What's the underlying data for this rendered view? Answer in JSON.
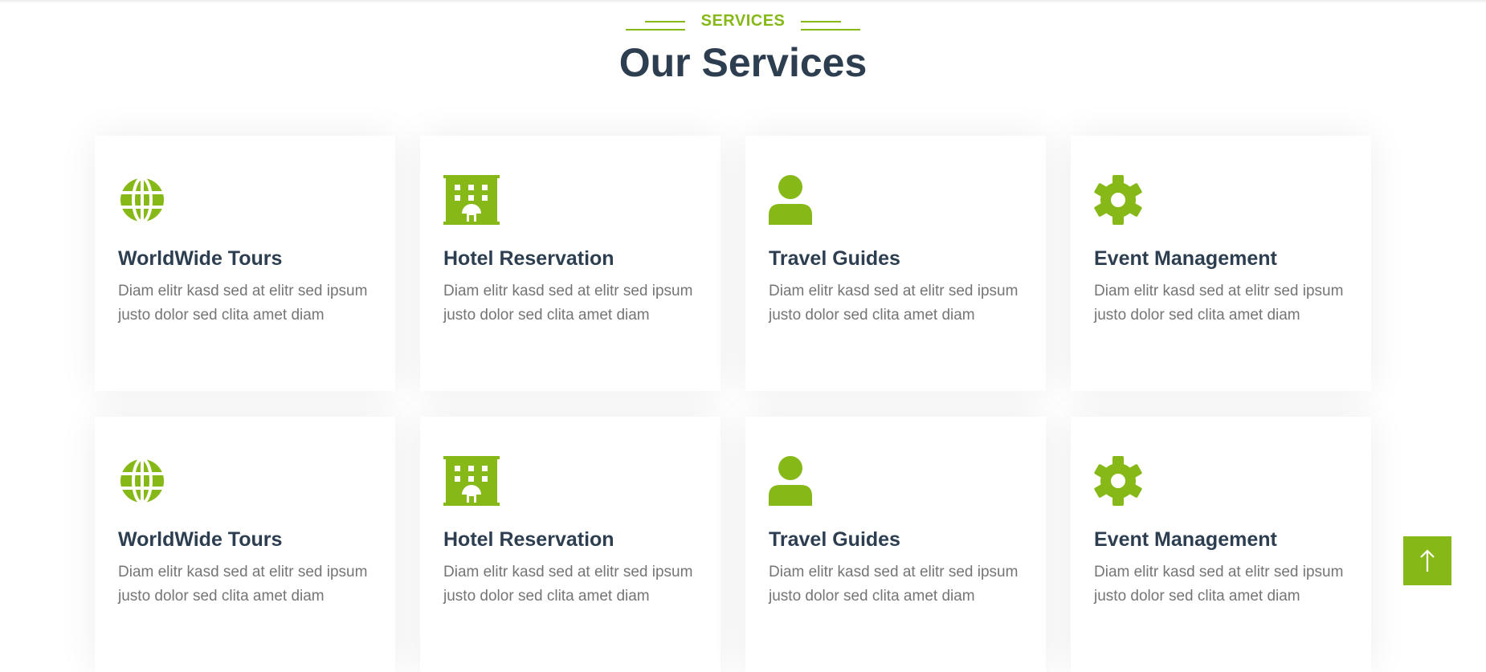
{
  "section": {
    "eyebrow": "SERVICES",
    "title": "Our Services"
  },
  "colors": {
    "accent": "#86b817",
    "heading": "#2c3e50",
    "body_text": "#757575"
  },
  "services": [
    {
      "title": "WorldWide Tours",
      "description": "Diam elitr kasd sed at elitr sed ipsum justo dolor sed clita amet diam",
      "icon": "globe-icon"
    },
    {
      "title": "Hotel Reservation",
      "description": "Diam elitr kasd sed at elitr sed ipsum justo dolor sed clita amet diam",
      "icon": "hotel-icon"
    },
    {
      "title": "Travel Guides",
      "description": "Diam elitr kasd sed at elitr sed ipsum justo dolor sed clita amet diam",
      "icon": "user-icon"
    },
    {
      "title": "Event Management",
      "description": "Diam elitr kasd sed at elitr sed ipsum justo dolor sed clita amet diam",
      "icon": "cog-icon"
    },
    {
      "title": "WorldWide Tours",
      "description": "Diam elitr kasd sed at elitr sed ipsum justo dolor sed clita amet diam",
      "icon": "globe-icon"
    },
    {
      "title": "Hotel Reservation",
      "description": "Diam elitr kasd sed at elitr sed ipsum justo dolor sed clita amet diam",
      "icon": "hotel-icon"
    },
    {
      "title": "Travel Guides",
      "description": "Diam elitr kasd sed at elitr sed ipsum justo dolor sed clita amet diam",
      "icon": "user-icon"
    },
    {
      "title": "Event Management",
      "description": "Diam elitr kasd sed at elitr sed ipsum justo dolor sed clita amet diam",
      "icon": "cog-icon"
    }
  ],
  "back_to_top": {
    "icon": "arrow-up-icon"
  }
}
